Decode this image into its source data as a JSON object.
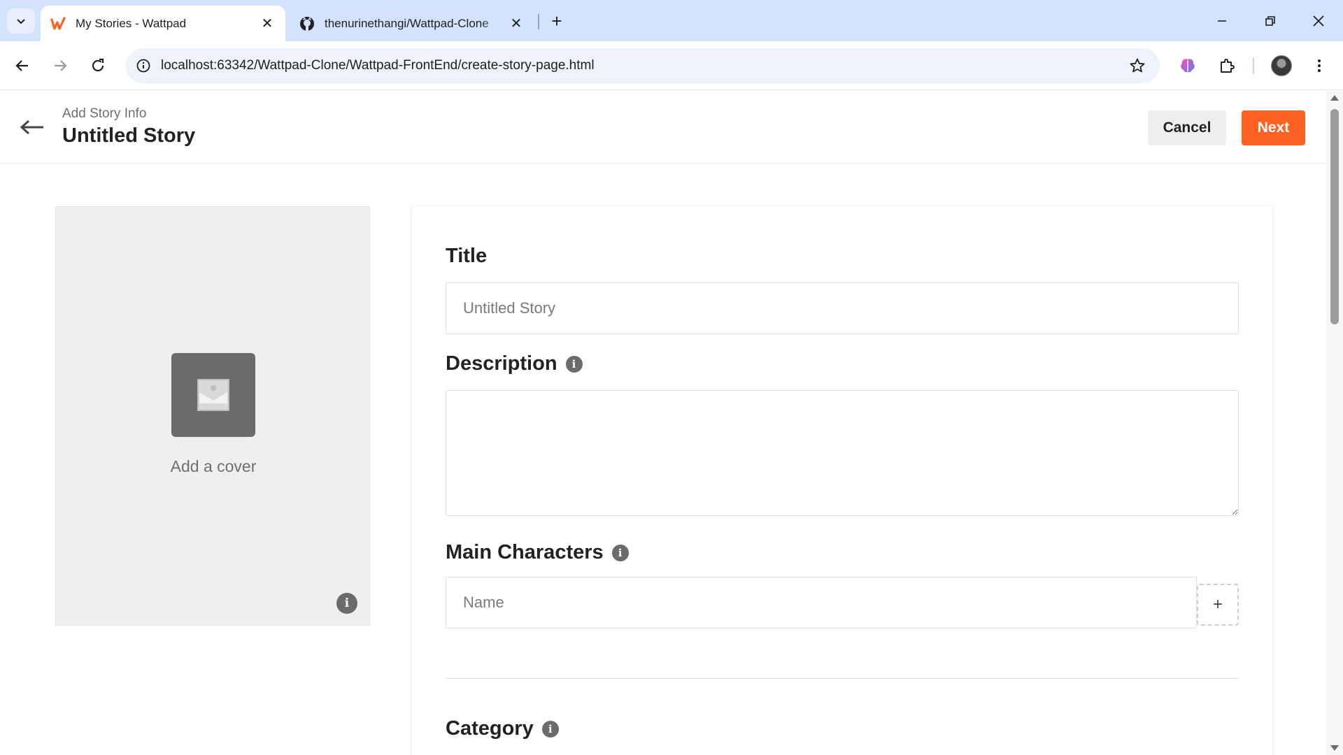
{
  "browser": {
    "tabs": [
      {
        "title": "My Stories - Wattpad",
        "favicon": "wattpad-w-icon",
        "active": true
      },
      {
        "title": "thenurinethangi/Wattpad-Clone",
        "favicon": "github-icon",
        "active": false
      }
    ],
    "url": "localhost:63342/Wattpad-Clone/Wattpad-FrontEnd/create-story-page.html",
    "colors": {
      "tabbar": "#d3e3fd",
      "omnibox": "#eef2f9"
    }
  },
  "header": {
    "subtitle": "Add Story Info",
    "title": "Untitled Story",
    "cancel_label": "Cancel",
    "next_label": "Next"
  },
  "cover": {
    "label": "Add a cover",
    "info_glyph": "i"
  },
  "form": {
    "title_label": "Title",
    "title_placeholder": "Untitled Story",
    "description_label": "Description",
    "description_value": "",
    "characters_label": "Main Characters",
    "characters_placeholder": "Name",
    "add_character_glyph": "+",
    "category_label": "Category",
    "info_glyph": "i"
  },
  "colors": {
    "accent": "#ff6122",
    "cancel_bg": "#eeeeee",
    "cover_bg": "#efefef"
  }
}
